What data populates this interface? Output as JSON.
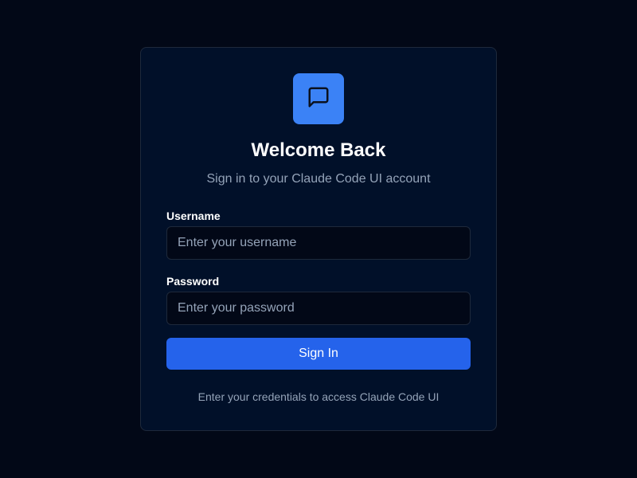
{
  "login": {
    "logo_icon": "chat-bubble-icon",
    "title": "Welcome Back",
    "subtitle": "Sign in to your Claude Code UI account",
    "username_label": "Username",
    "username_placeholder": "Enter your username",
    "username_value": "",
    "password_label": "Password",
    "password_placeholder": "Enter your password",
    "password_value": "",
    "submit_label": "Sign In",
    "footer_text": "Enter your credentials to access Claude Code UI"
  },
  "colors": {
    "background": "#020817",
    "card": "#011029",
    "accent": "#3b82f6",
    "button": "#2563eb",
    "muted_text": "#94a3b8"
  }
}
